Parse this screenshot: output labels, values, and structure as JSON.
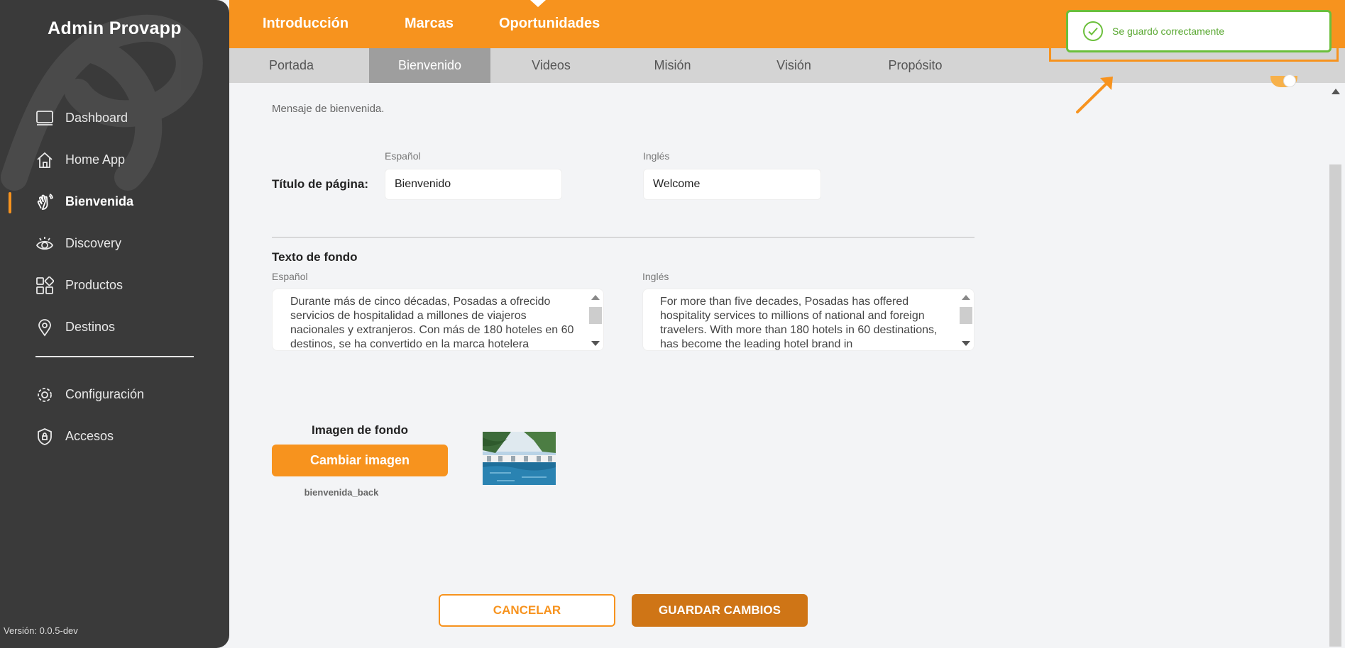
{
  "app": {
    "title": "Admin Provapp",
    "version": "Versión: 0.0.5-dev"
  },
  "sidebar": {
    "items": [
      {
        "label": "Dashboard",
        "icon": "monitor-icon"
      },
      {
        "label": "Home App",
        "icon": "home-icon"
      },
      {
        "label": "Bienvenida",
        "icon": "waving-hand-icon",
        "active": true
      },
      {
        "label": "Discovery",
        "icon": "eye-icon"
      },
      {
        "label": "Productos",
        "icon": "grid-icon"
      },
      {
        "label": "Destinos",
        "icon": "map-pin-icon"
      }
    ],
    "bottom_items": [
      {
        "label": "Configuración",
        "icon": "gear-icon"
      },
      {
        "label": "Accesos",
        "icon": "shield-lock-icon"
      }
    ]
  },
  "topnav": {
    "tabs": [
      "Introducción",
      "Marcas",
      "Oportunidades"
    ],
    "active": "Introducción"
  },
  "subnav": {
    "tabs": [
      "Portada",
      "Bienvenido",
      "Videos",
      "Misión",
      "Visión",
      "Propósito"
    ],
    "active": "Bienvenido"
  },
  "toast": {
    "message": "Se guardó correctamente"
  },
  "content": {
    "hint": "Mensaje de bienvenida.",
    "title_section": {
      "label": "Título de página:",
      "es_label": "Español",
      "en_label": "Inglés",
      "es_value": "Bienvenido",
      "en_value": "Welcome"
    },
    "background_text": {
      "label": "Texto de fondo",
      "es_label": "Español",
      "en_label": "Inglés",
      "es_value": "Durante más de cinco décadas, Posadas a ofrecido servicios de hospitalidad a millones de viajeros nacionales y extranjeros. Con más de 180 hoteles en 60 destinos, se ha convertido en la marca hotelera",
      "en_value": "For more than five decades, Posadas has offered hospitality services to millions of national and foreign travelers. With more than 180 hotels in 60 destinations, has become the leading hotel brand in"
    },
    "background_image": {
      "label": "Imagen de fondo",
      "button": "Cambiar imagen",
      "filename": "bienvenida_back"
    }
  },
  "actions": {
    "cancel": "CANCELAR",
    "save": "GUARDAR CAMBIOS"
  },
  "colors": {
    "accent": "#f7931e",
    "sidebar": "#3a3a3a",
    "success": "#6bbf3b",
    "save_button": "#cf7516"
  }
}
